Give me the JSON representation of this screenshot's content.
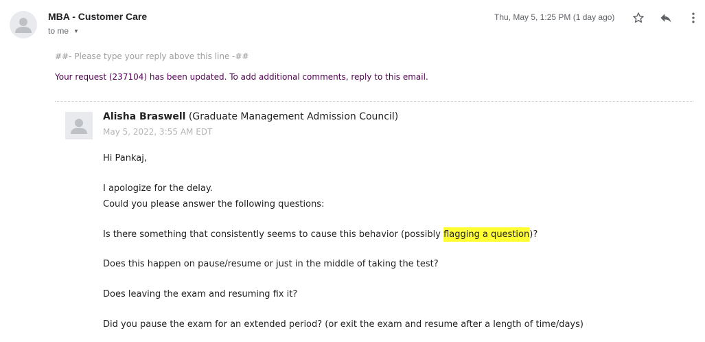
{
  "header": {
    "sender": "MBA - Customer Care",
    "recipient": "to me",
    "date": "Thu, May 5, 1:25 PM (1 day ago)",
    "icons": [
      "avatar-icon",
      "star-icon",
      "reply-icon",
      "more-vert-icon"
    ]
  },
  "body": {
    "separator": "##- Please type your reply above this line -##",
    "request_update": "Your request (237104) has been updated. To add additional comments, reply to this email.",
    "comment": {
      "author_name": "Alisha Braswell",
      "author_org": "(Graduate Management Admission Council)",
      "timestamp": "May 5, 2022, 3:55 AM EDT",
      "greeting": "Hi Pankaj,",
      "line1": "I apologize for the delay.",
      "line2": "Could you please answer the following questions:",
      "q1_before": "Is there something that consistently seems to cause this behavior (possibly ",
      "q1_highlight": "flagging a question",
      "q1_after": ")?",
      "q2": "Does this happen on pause/resume or just in the middle of taking the test?",
      "q3": "Does leaving the exam and resuming fix it?",
      "q4": "Did you pause the exam for an extended period? (or exit the exam and resume after a length of time/days)"
    }
  },
  "colors": {
    "highlight": "#ffff33",
    "request_text": "#500050",
    "muted": "#5f6368",
    "separator_text": "#9e9e9e"
  }
}
